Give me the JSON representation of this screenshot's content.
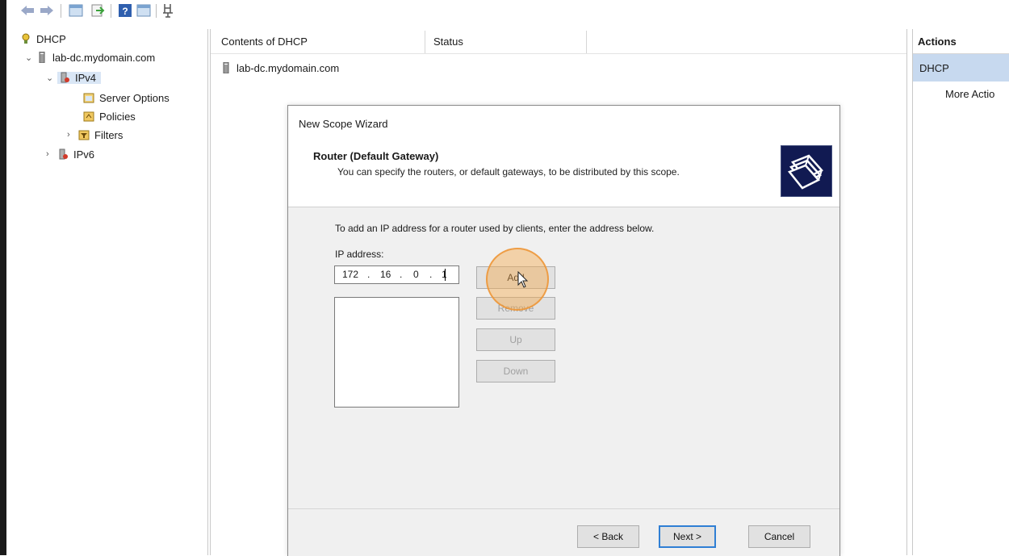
{
  "tree": {
    "root": "DHCP",
    "server": "lab-dc.mydomain.com",
    "ipv4": "IPv4",
    "server_options": "Server Options",
    "policies": "Policies",
    "filters": "Filters",
    "ipv6": "IPv6"
  },
  "content": {
    "col_contents": "Contents of DHCP",
    "col_status": "Status",
    "row_server": "lab-dc.mydomain.com"
  },
  "actions": {
    "title": "Actions",
    "selected": "DHCP",
    "more": "More Actio"
  },
  "wizard": {
    "title": "New Scope Wizard",
    "heading": "Router (Default Gateway)",
    "subheading": "You can specify the routers, or default gateways, to be distributed by this scope.",
    "instruction": "To add an IP address for a router used by clients, enter the address below.",
    "ip_label": "IP address:",
    "ip_octets": [
      "172",
      "16",
      "0",
      "1"
    ],
    "buttons": {
      "add": "Add",
      "remove": "Remove",
      "up": "Up",
      "down": "Down",
      "back": "< Back",
      "next": "Next >",
      "cancel": "Cancel"
    }
  },
  "colors": {
    "selection": "#c7d9ef",
    "wizard_logo": "#111a52",
    "click_highlight": "#f4aa50"
  }
}
